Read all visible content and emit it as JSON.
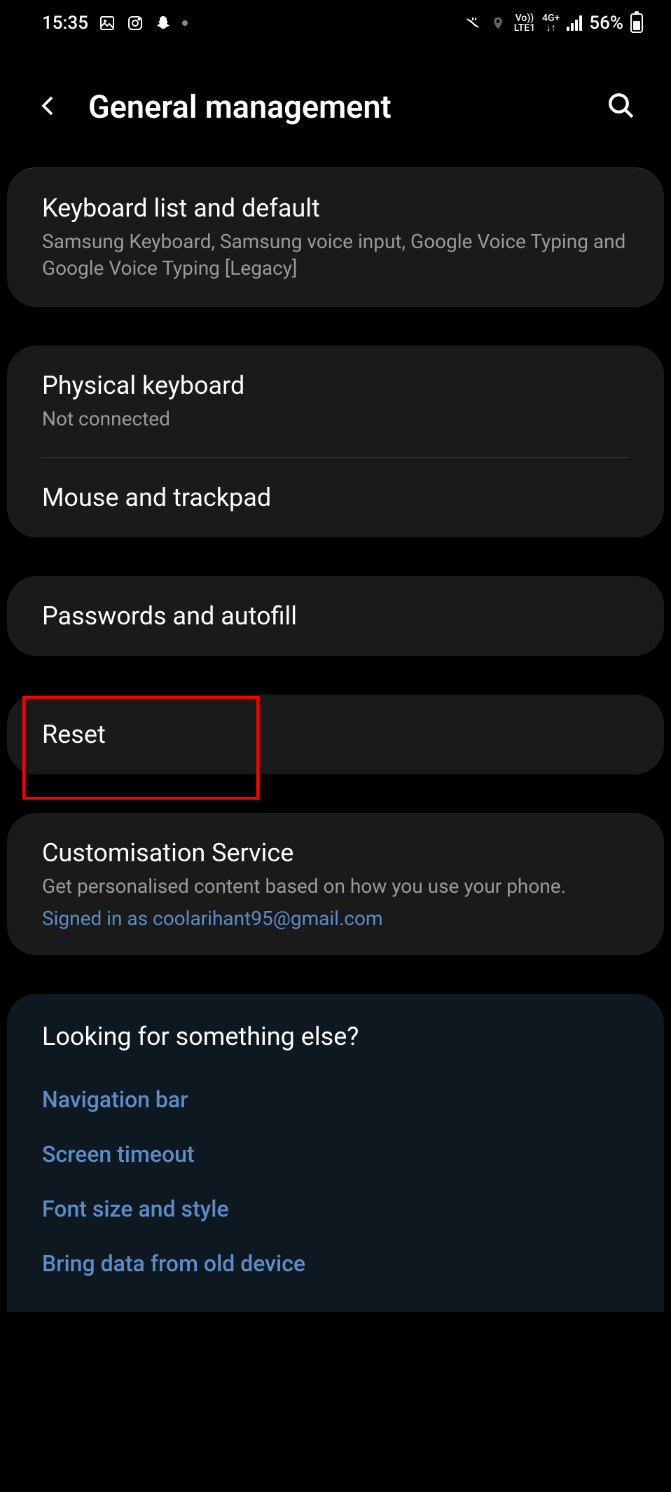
{
  "status_bar": {
    "time": "15:35",
    "battery_percent": "56%",
    "network_top": "Vo))",
    "network_bottom": "LTE1",
    "data_type": "4G+"
  },
  "header": {
    "title": "General management"
  },
  "sections": {
    "keyboard_list": {
      "title": "Keyboard list and default",
      "subtitle": "Samsung Keyboard, Samsung voice input, Google Voice Typing and Google Voice Typing [Legacy]"
    },
    "physical_keyboard": {
      "title": "Physical keyboard",
      "subtitle": "Not connected"
    },
    "mouse_trackpad": {
      "title": "Mouse and trackpad"
    },
    "passwords_autofill": {
      "title": "Passwords and autofill"
    },
    "reset": {
      "title": "Reset"
    },
    "customisation": {
      "title": "Customisation Service",
      "subtitle": "Get personalised content based on how you use your phone.",
      "signed_in": "Signed in as coolarihant95@gmail.com"
    },
    "looking_for": {
      "title": "Looking for something else?",
      "links": [
        "Navigation bar",
        "Screen timeout",
        "Font size and style",
        "Bring data from old device"
      ]
    }
  }
}
